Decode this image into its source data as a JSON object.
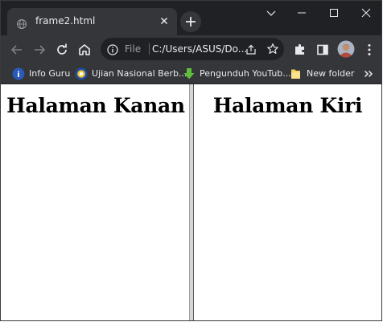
{
  "browser": {
    "tab": {
      "title": "frame2.html",
      "favicon": "globe-icon",
      "close_icon": "close-icon"
    },
    "new_tab_icon": "plus-icon",
    "window_controls": [
      "chevron-down-icon",
      "minimize-icon",
      "maximize-icon",
      "close-icon"
    ],
    "toolbar": {
      "back_icon": "arrow-left-icon",
      "forward_icon": "arrow-right-icon",
      "reload_icon": "reload-icon",
      "home_icon": "home-icon",
      "omnibox": {
        "info_icon": "info-icon",
        "scheme_label": "File",
        "url": "C:/Users/ASUS/Do...",
        "share_icon": "share-icon",
        "star_icon": "star-icon"
      },
      "extensions_icon": "puzzle-icon",
      "sidepanel_icon": "side-panel-icon",
      "avatar_icon": "profile-avatar",
      "menu_icon": "kebab-menu-icon"
    },
    "bookmarks": [
      {
        "label": "Info Guru",
        "icon": "bookmark-favicon-blue"
      },
      {
        "label": "Ujian Nasional Berb...",
        "icon": "bookmark-favicon-tutwuri"
      },
      {
        "label": "Pengunduh YouTub...",
        "icon": "bookmark-favicon-download"
      },
      {
        "label": "New folder",
        "icon": "folder-icon"
      }
    ],
    "bookmarks_overflow_icon": "chevron-double-right-icon"
  },
  "page": {
    "frames": [
      {
        "heading": "Halaman Kanan"
      },
      {
        "heading": "Halaman Kiri"
      }
    ]
  },
  "colors": {
    "titlebar": "#202124",
    "toolbar": "#35363a",
    "omnibox": "#202124",
    "text_light": "#e8eaed",
    "text_dim": "#9aa0a6",
    "page_bg": "#ffffff",
    "heading_text": "#000000"
  }
}
